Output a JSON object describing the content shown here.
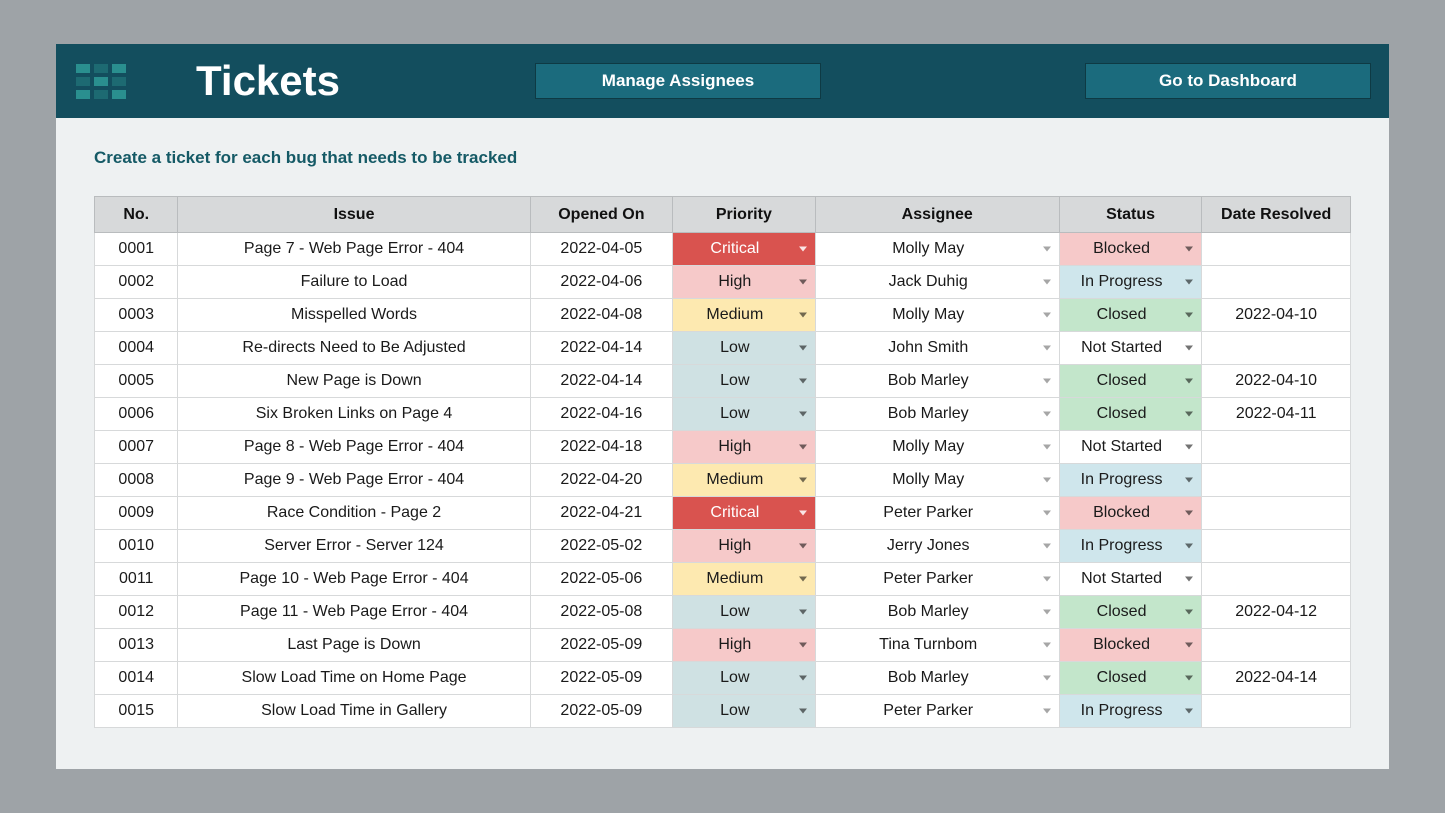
{
  "header": {
    "title": "Tickets",
    "manage_btn": "Manage Assignees",
    "dashboard_btn": "Go to Dashboard"
  },
  "subtitle": "Create a ticket for each bug that needs to be tracked",
  "columns": {
    "no": "No.",
    "issue": "Issue",
    "opened": "Opened On",
    "priority": "Priority",
    "assignee": "Assignee",
    "status": "Status",
    "resolved": "Date Resolved"
  },
  "rows": [
    {
      "no": "0001",
      "issue": "Page 7 - Web Page Error - 404",
      "opened": "2022-04-05",
      "priority": "Critical",
      "assignee": "Molly May",
      "status": "Blocked",
      "resolved": ""
    },
    {
      "no": "0002",
      "issue": "Failure to Load",
      "opened": "2022-04-06",
      "priority": "High",
      "assignee": "Jack Duhig",
      "status": "In Progress",
      "resolved": ""
    },
    {
      "no": "0003",
      "issue": "Misspelled Words",
      "opened": "2022-04-08",
      "priority": "Medium",
      "assignee": "Molly May",
      "status": "Closed",
      "resolved": "2022-04-10"
    },
    {
      "no": "0004",
      "issue": "Re-directs Need to Be Adjusted",
      "opened": "2022-04-14",
      "priority": "Low",
      "assignee": "John Smith",
      "status": "Not Started",
      "resolved": ""
    },
    {
      "no": "0005",
      "issue": "New Page is Down",
      "opened": "2022-04-14",
      "priority": "Low",
      "assignee": "Bob Marley",
      "status": "Closed",
      "resolved": "2022-04-10"
    },
    {
      "no": "0006",
      "issue": "Six Broken Links on Page 4",
      "opened": "2022-04-16",
      "priority": "Low",
      "assignee": "Bob Marley",
      "status": "Closed",
      "resolved": "2022-04-11"
    },
    {
      "no": "0007",
      "issue": "Page 8 - Web Page Error - 404",
      "opened": "2022-04-18",
      "priority": "High",
      "assignee": "Molly May",
      "status": "Not Started",
      "resolved": ""
    },
    {
      "no": "0008",
      "issue": "Page 9 - Web Page Error - 404",
      "opened": "2022-04-20",
      "priority": "Medium",
      "assignee": "Molly May",
      "status": "In Progress",
      "resolved": ""
    },
    {
      "no": "0009",
      "issue": "Race Condition - Page 2",
      "opened": "2022-04-21",
      "priority": "Critical",
      "assignee": "Peter Parker",
      "status": "Blocked",
      "resolved": ""
    },
    {
      "no": "0010",
      "issue": "Server Error - Server 124",
      "opened": "2022-05-02",
      "priority": "High",
      "assignee": "Jerry Jones",
      "status": "In Progress",
      "resolved": ""
    },
    {
      "no": "0011",
      "issue": "Page 10 - Web Page Error - 404",
      "opened": "2022-05-06",
      "priority": "Medium",
      "assignee": "Peter Parker",
      "status": "Not Started",
      "resolved": ""
    },
    {
      "no": "0012",
      "issue": "Page 11 - Web Page Error - 404",
      "opened": "2022-05-08",
      "priority": "Low",
      "assignee": "Bob Marley",
      "status": "Closed",
      "resolved": "2022-04-12"
    },
    {
      "no": "0013",
      "issue": "Last Page is Down",
      "opened": "2022-05-09",
      "priority": "High",
      "assignee": "Tina Turnbom",
      "status": "Blocked",
      "resolved": ""
    },
    {
      "no": "0014",
      "issue": "Slow Load Time on Home Page",
      "opened": "2022-05-09",
      "priority": "Low",
      "assignee": "Bob Marley",
      "status": "Closed",
      "resolved": "2022-04-14"
    },
    {
      "no": "0015",
      "issue": "Slow Load Time in Gallery",
      "opened": "2022-05-09",
      "priority": "Low",
      "assignee": "Peter Parker",
      "status": "In Progress",
      "resolved": ""
    }
  ]
}
